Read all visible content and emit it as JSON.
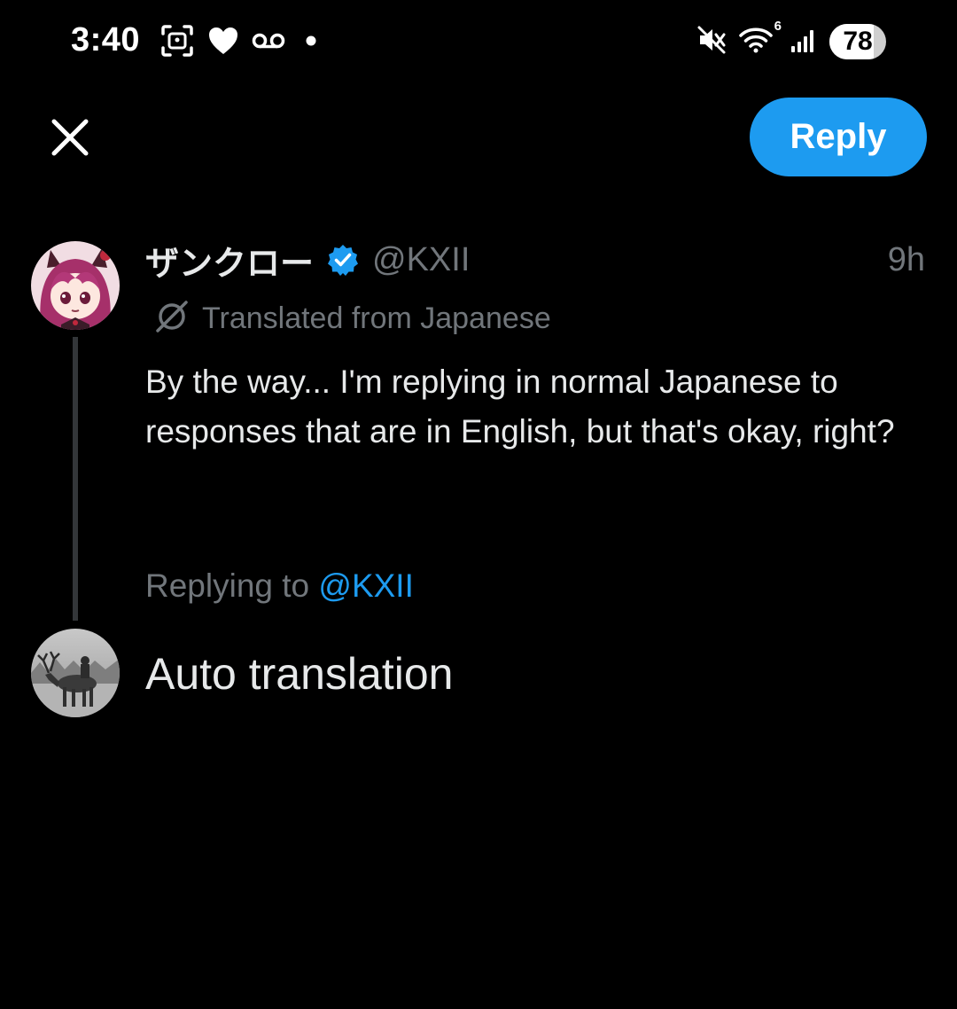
{
  "status_bar": {
    "time": "3:40",
    "battery_level": "78",
    "battery_fraction": 0.78,
    "left_icons": [
      "screenshot-icon",
      "heart-icon",
      "voicemail-icon",
      "notification-dot-icon"
    ],
    "right_icons": [
      "vibrate-mute-icon",
      "wifi-icon",
      "cellular-signal-icon",
      "battery-icon"
    ],
    "wifi_label": "6"
  },
  "toolbar": {
    "close_icon": "close-icon",
    "reply_label": "Reply"
  },
  "tweet": {
    "author_name": "ザンクロー",
    "verified": true,
    "handle": "@KXII",
    "time": "9h",
    "translated_label": "Translated from Japanese",
    "body": "By the way... I'm replying in normal Japanese to responses that are in English, but that's okay, right?"
  },
  "replying": {
    "prefix": "Replying to ",
    "handle": "@KXII"
  },
  "composer": {
    "text": "Auto translation"
  },
  "colors": {
    "background": "#000000",
    "accent": "#1d9bf0",
    "text_primary": "#e7e9ea",
    "text_secondary": "#71767b",
    "thread_line": "#333639"
  }
}
